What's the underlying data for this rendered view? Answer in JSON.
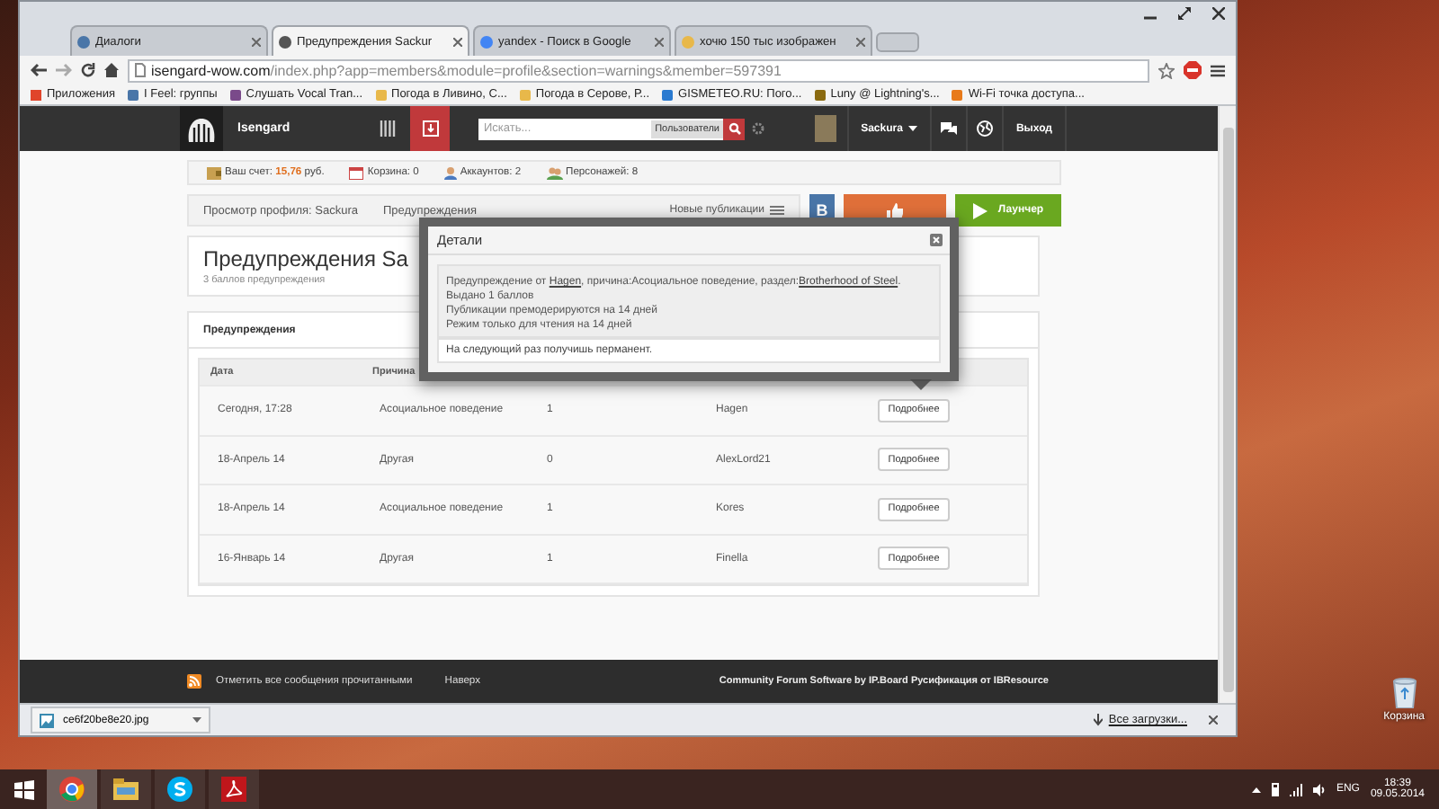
{
  "browser": {
    "tabs": [
      {
        "title": "Диалоги",
        "selected": false
      },
      {
        "title": "Предупреждения Sackur",
        "selected": true
      },
      {
        "title": "yandex - Поиск в Google",
        "selected": false
      },
      {
        "title": "хочю 150 тыс изображен",
        "selected": false
      }
    ],
    "address": {
      "domain": "isengard-wow.com",
      "path": "/index.php?app=members&module=profile&section=warnings&member=597391"
    },
    "bookmarks": [
      {
        "label": "Приложения",
        "kind": "apps",
        "color": "#e0452b"
      },
      {
        "label": "I Feel: группы",
        "kind": "site",
        "color": "#4a76a8"
      },
      {
        "label": "Слушать Vocal Tran...",
        "kind": "site",
        "color": "#7a4a8a"
      },
      {
        "label": "Погода в Ливино, С...",
        "kind": "site",
        "color": "#e8b84a"
      },
      {
        "label": "Погода в Серове, Р...",
        "kind": "site",
        "color": "#e8b84a"
      },
      {
        "label": "GISMETEO.RU: Пого...",
        "kind": "site",
        "color": "#2a7ad0"
      },
      {
        "label": "Luny @ Lightning's...",
        "kind": "site",
        "color": "#8a6a10"
      },
      {
        "label": "Wi-Fi точка доступа...",
        "kind": "site",
        "color": "#e87a1a"
      }
    ],
    "download": {
      "file": "ce6f20be8e20.jpg",
      "all": "Все загрузки..."
    }
  },
  "site": {
    "name": "Isengard",
    "search": {
      "placeholder": "Искать...",
      "scope": "Пользователи"
    },
    "user": "Sackura",
    "logout": "Выход",
    "balance": {
      "label": "Ваш счет:",
      "amount": "15,76",
      "unit": "руб."
    },
    "counters": [
      {
        "label": "Корзина: 0",
        "kind": "cart"
      },
      {
        "label": "Аккаунтов: 2",
        "kind": "person"
      },
      {
        "label": "Персонажей: 8",
        "kind": "people"
      }
    ],
    "breadcrumbs": [
      "Просмотр профиля: Sackura",
      "Предупреждения"
    ],
    "new_posts": "Новые публикации",
    "vk": "В",
    "launcher": "Лаунчер",
    "title": "Предупреждения Sa",
    "subtitle": "3 баллов предупреждения",
    "warnings": {
      "heading": "Предупреждения",
      "columns": [
        "Дата",
        "Причина"
      ],
      "rows": [
        {
          "date": "Сегодня, 17:28",
          "reason": "Асоциальное поведение",
          "points": "1",
          "moderator": "Hagen",
          "button": "Подробнее"
        },
        {
          "date": "18-Апрель 14",
          "reason": "Другая",
          "points": "0",
          "moderator": "AlexLord21",
          "button": "Подробнее"
        },
        {
          "date": "18-Апрель 14",
          "reason": "Асоциальное поведение",
          "points": "1",
          "moderator": "Kores",
          "button": "Подробнее"
        },
        {
          "date": "16-Январь 14",
          "reason": "Другая",
          "points": "1",
          "moderator": "Finella",
          "button": "Подробнее"
        }
      ]
    },
    "footer": {
      "mark_read": "Отметить все сообщения прочитанными",
      "top": "Наверх",
      "credits": "Community Forum Software by IP.Board Русификация от IBResource"
    }
  },
  "dialog": {
    "title": "Детали",
    "first_line": [
      {
        "text": "Предупреждение от "
      },
      {
        "text": "Hagen",
        "link": true
      },
      {
        "text": ", причина:Асоциальное поведение, раздел:"
      },
      {
        "text": "Brotherhood of Steel",
        "link": true
      },
      {
        "text": "."
      }
    ],
    "lines": [
      "Выдано 1 баллов",
      "Публикации премодерируются на 14 дней",
      "Режим только для чтения на 14 дней"
    ],
    "note": "На следующий раз получишь перманент."
  },
  "desktop": {
    "recycle_bin": "Корзина"
  },
  "taskbar": {
    "apps": [
      {
        "kind": "chrome",
        "selected": true
      },
      {
        "kind": "explorer",
        "selected": false
      },
      {
        "kind": "skype",
        "selected": false
      },
      {
        "kind": "acrobat",
        "selected": false
      }
    ],
    "lang": "ENG",
    "time": "18:39",
    "date": "09.05.2014"
  }
}
